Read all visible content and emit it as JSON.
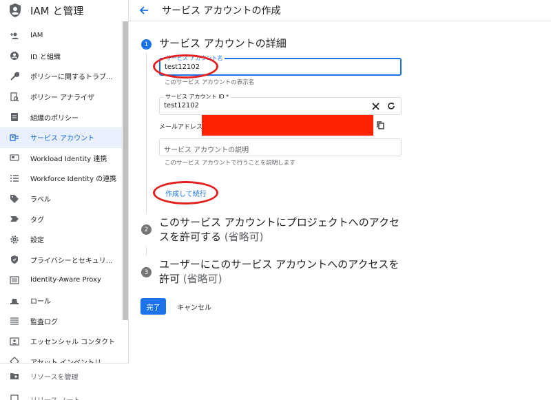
{
  "sidebar": {
    "title": "IAM と管理",
    "items": [
      {
        "label": "IAM",
        "icon": "person-add-icon"
      },
      {
        "label": "ID と組織",
        "icon": "account-circle-icon"
      },
      {
        "label": "ポリシーに関するトラブ...",
        "icon": "wrench-icon"
      },
      {
        "label": "ポリシー アナライザ",
        "icon": "policy-analyzer-icon"
      },
      {
        "label": "組織のポリシー",
        "icon": "document-icon"
      },
      {
        "label": "サービス アカウント",
        "icon": "service-account-icon",
        "active": true
      },
      {
        "label": "Workload Identity 連携",
        "icon": "id-card-icon"
      },
      {
        "label": "Workforce Identity の連携",
        "icon": "list-icon"
      },
      {
        "label": "ラベル",
        "icon": "tag-icon"
      },
      {
        "label": "タグ",
        "icon": "chevron-tag-icon"
      },
      {
        "label": "設定",
        "icon": "gear-icon"
      },
      {
        "label": "プライバシーとセキュリ...",
        "icon": "shield-icon"
      },
      {
        "label": "Identity-Aware Proxy",
        "icon": "proxy-icon"
      },
      {
        "label": "ロール",
        "icon": "hat-icon"
      },
      {
        "label": "監査ログ",
        "icon": "lines-icon"
      },
      {
        "label": "エッセンシャル コンタクト",
        "icon": "contact-icon"
      },
      {
        "label": "アセット インベントリ",
        "icon": "inventory-icon"
      }
    ],
    "footer": [
      {
        "label": "リソースを管理",
        "icon": "folder-gear-icon"
      },
      {
        "label": "リリース ノート",
        "icon": "notes-icon"
      }
    ]
  },
  "header": {
    "title": "サービス アカウントの作成"
  },
  "steps": [
    {
      "number": "1",
      "title": "サービス アカウントの詳細"
    },
    {
      "number": "2",
      "title_line1": "このサービス アカウントにプロジェクトへのアクセ",
      "title_line2": "スを許可する",
      "optional": "(省略可)"
    },
    {
      "number": "3",
      "title_line1": "ユーザーにこのサービス アカウントへのアクセスを",
      "title_line2": "許可",
      "optional": "(省略可)"
    }
  ],
  "form": {
    "name_label": "サービス アカウント名",
    "name_value": "test12102",
    "name_hint": "このサービス アカウントの表示名",
    "id_label": "サービス アカウント ID *",
    "id_value": "test12102",
    "email_label": "メールアドレス:",
    "description_placeholder": "サービス アカウントの説明",
    "description_hint": "このサービス アカウントで行うことを説明します",
    "create_continue": "作成して続行"
  },
  "actions": {
    "done": "完了",
    "cancel": "キャンセル"
  },
  "colors": {
    "accent": "#1a73e8",
    "redaction": "#ff2200",
    "annotation": "#e32020"
  }
}
